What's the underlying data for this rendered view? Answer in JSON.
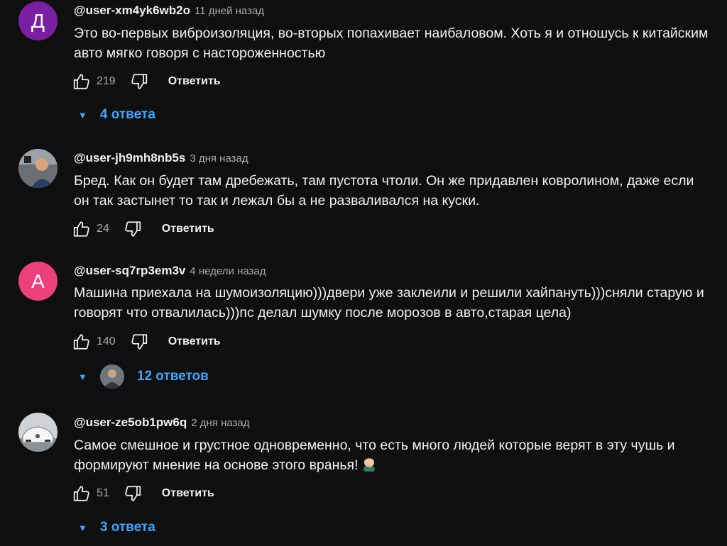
{
  "actions": {
    "reply_label": "Ответить"
  },
  "comments": [
    {
      "avatar_letter": "Д",
      "avatar_color": "#7b1fa2",
      "author": "@user-xm4yk6wb2o",
      "time": "11 дней назад",
      "text": "Это во-первых виброизоляция, во-вторых попахивает наибаловом. Хоть я и отношусь к китайским авто мягко говоря с настороженностью",
      "likes": "219",
      "replies": "4 ответа"
    },
    {
      "avatar_letter": "",
      "avatar_color": "#3a3a3a",
      "author": "@user-jh9mh8nb5s",
      "time": "3 дня назад",
      "text": "Бред. Как он будет там дребежать, там пустота чтоли. Он же придавлен ковролином, даже если он так застынет то так и лежал бы а не разваливался на куски.",
      "likes": "24"
    },
    {
      "avatar_letter": "А",
      "avatar_color": "#ec407a",
      "author": "@user-sq7rp3em3v",
      "time": "4 недели назад",
      "text": "Машина приехала на шумоизоляцию)))двери уже заклеили и решили хайпануть)))сняли старую и говорят что отвалилась)))пс делал шумку после морозов в авто,старая цела)",
      "likes": "140",
      "replies": "12 ответов"
    },
    {
      "avatar_letter": "",
      "avatar_color": "#3a3a3a",
      "author": "@user-ze5ob1pw6q",
      "time": "2 дня назад",
      "text": "Самое смешное и грустное одновременно, что есть много людей которые верят в эту чушь и формируют мнение на основе этого вранья!",
      "emoji": "facepalm",
      "likes": "51",
      "replies": "3 ответа"
    }
  ]
}
